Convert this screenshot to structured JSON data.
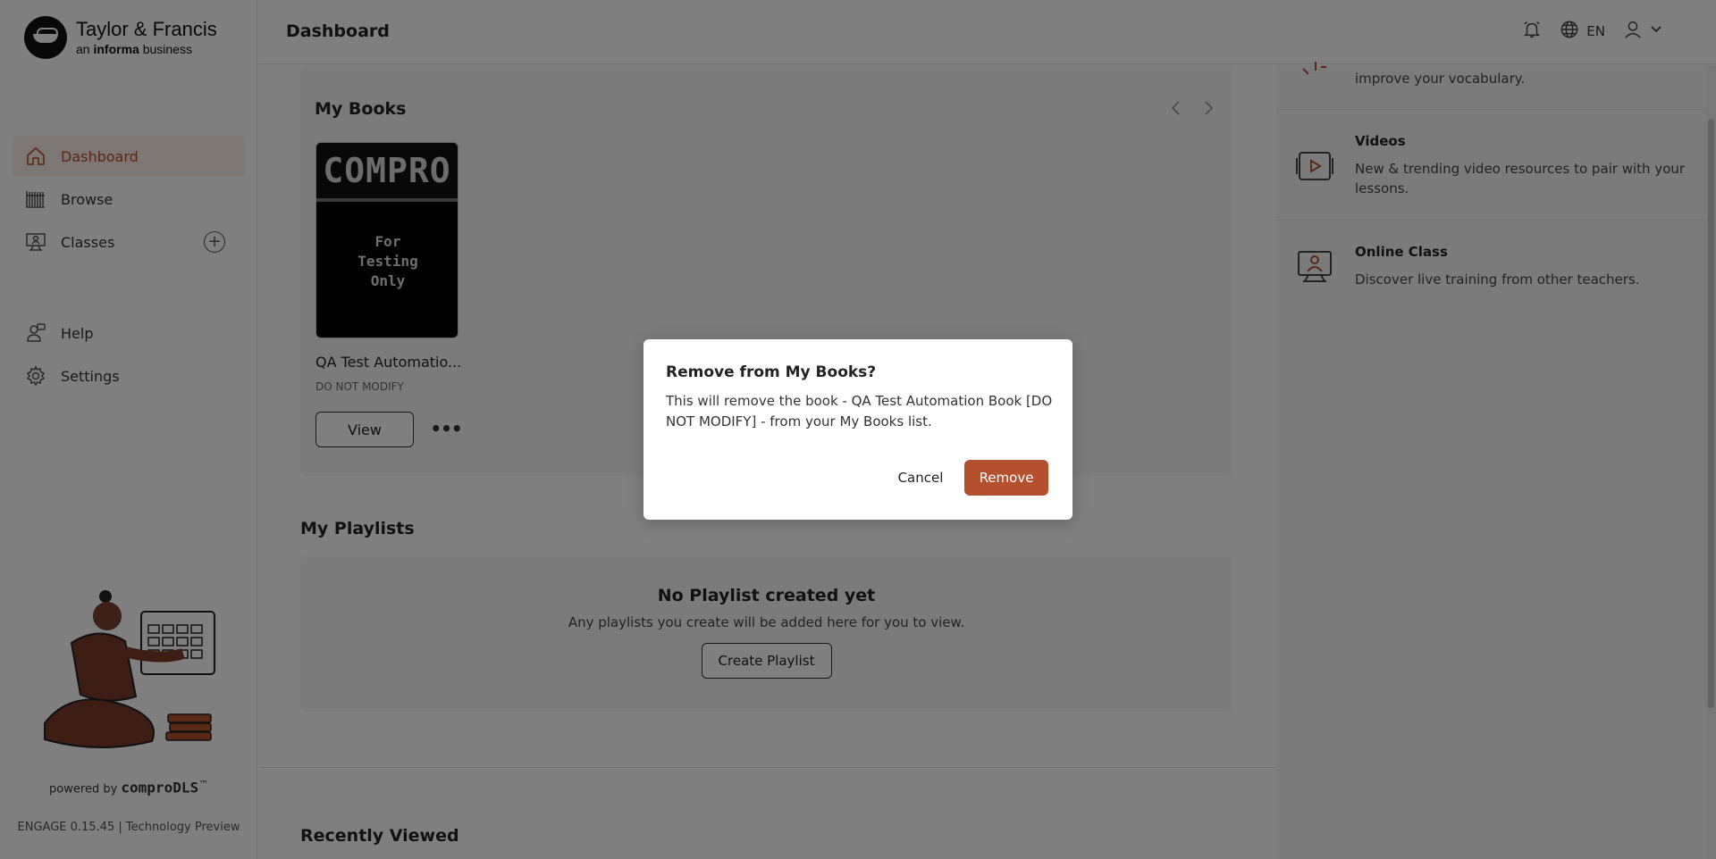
{
  "brand": {
    "name": "Taylor & Francis",
    "tagline_prefix": "an ",
    "tagline_bold": "informa",
    "tagline_suffix": " business"
  },
  "sidebar": {
    "items": [
      {
        "label": "Dashboard",
        "icon": "home-icon",
        "active": true
      },
      {
        "label": "Browse",
        "icon": "bookshelf-icon"
      },
      {
        "label": "Classes",
        "icon": "classroom-icon"
      },
      {
        "label": "Help",
        "icon": "help-person-icon"
      },
      {
        "label": "Settings",
        "icon": "gear-icon"
      }
    ],
    "powered_prefix": "powered by ",
    "powered_brand": "comproDLS",
    "powered_tm": "™",
    "version": "ENGAGE 0.15.45 | Technology Preview"
  },
  "header": {
    "title": "Dashboard",
    "language": "EN"
  },
  "my_books": {
    "title": "My Books",
    "book": {
      "cover_brand": "COMPRO",
      "cover_note": "For Testing Only",
      "name": "QA Test Automatio...",
      "subtitle": "DO NOT MODIFY",
      "view_label": "View",
      "more_label": "•••"
    }
  },
  "my_playlists": {
    "title": "My Playlists",
    "empty_title": "No Playlist created yet",
    "empty_text": "Any playlists you create will be added here for you to view.",
    "create_label": "Create Playlist"
  },
  "recently_viewed": {
    "title": "Recently Viewed"
  },
  "right_panel": {
    "items": [
      {
        "title": "",
        "desc": "improve your vocabulary.",
        "icon": "vocabulary-icon"
      },
      {
        "title": "Videos",
        "desc": "New & trending video resources to pair with your lessons.",
        "icon": "video-icon"
      },
      {
        "title": "Online Class",
        "desc": "Discover live training from other teachers.",
        "icon": "online-class-icon"
      }
    ]
  },
  "modal": {
    "title": "Remove from My Books?",
    "body": "This will remove the book - QA Test Automation Book [DO NOT MODIFY] - from your My Books list.",
    "cancel_label": "Cancel",
    "remove_label": "Remove"
  },
  "colors": {
    "accent": "#b5502f",
    "active_bg": "#fbeee9",
    "overlay": "rgba(0,0,0,0.5)"
  }
}
